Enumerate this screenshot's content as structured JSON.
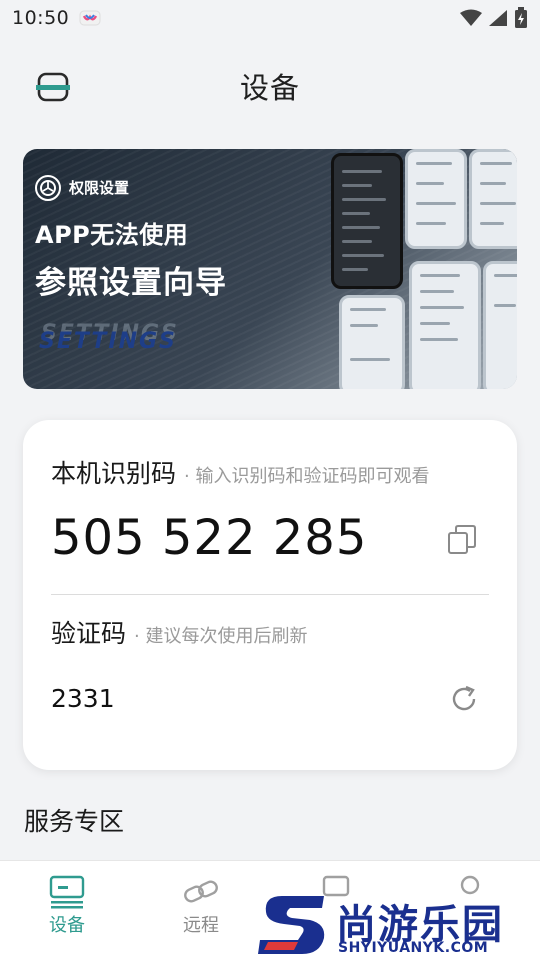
{
  "status_bar": {
    "time": "10:50"
  },
  "header": {
    "title": "设备"
  },
  "banner": {
    "tag": "权限设置",
    "line1": "APP无法使用",
    "line2": "参照设置向导",
    "ghost_text": "SETTINGS"
  },
  "device_card": {
    "id_label": "本机识别码",
    "id_hint": "· 输入识别码和验证码即可观看",
    "id_code": "505 522 285",
    "verify_label": "验证码",
    "verify_hint": "· 建议每次使用后刷新",
    "verify_code": "2331"
  },
  "section": {
    "title": "服务专区"
  },
  "bottom_nav": {
    "items": [
      {
        "label": "设备",
        "icon": "device-icon",
        "active": true
      },
      {
        "label": "远程",
        "icon": "link-icon",
        "active": false
      }
    ]
  },
  "watermark": {
    "cn": "尚游乐园",
    "en": "SHYIYUANYK.COM"
  },
  "colors": {
    "accent": "#2f9b8f",
    "background": "#f2f3f5",
    "watermark": "#1a2f8f"
  }
}
